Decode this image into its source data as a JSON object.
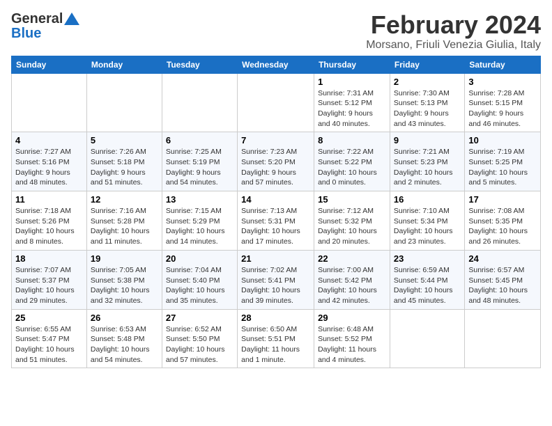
{
  "logo": {
    "general": "General",
    "blue": "Blue"
  },
  "title": {
    "month": "February 2024",
    "location": "Morsano, Friuli Venezia Giulia, Italy"
  },
  "headers": [
    "Sunday",
    "Monday",
    "Tuesday",
    "Wednesday",
    "Thursday",
    "Friday",
    "Saturday"
  ],
  "weeks": [
    [
      {
        "day": "",
        "sunrise": "",
        "sunset": "",
        "daylight": ""
      },
      {
        "day": "",
        "sunrise": "",
        "sunset": "",
        "daylight": ""
      },
      {
        "day": "",
        "sunrise": "",
        "sunset": "",
        "daylight": ""
      },
      {
        "day": "",
        "sunrise": "",
        "sunset": "",
        "daylight": ""
      },
      {
        "day": "1",
        "sunrise": "Sunrise: 7:31 AM",
        "sunset": "Sunset: 5:12 PM",
        "daylight": "Daylight: 9 hours and 40 minutes."
      },
      {
        "day": "2",
        "sunrise": "Sunrise: 7:30 AM",
        "sunset": "Sunset: 5:13 PM",
        "daylight": "Daylight: 9 hours and 43 minutes."
      },
      {
        "day": "3",
        "sunrise": "Sunrise: 7:28 AM",
        "sunset": "Sunset: 5:15 PM",
        "daylight": "Daylight: 9 hours and 46 minutes."
      }
    ],
    [
      {
        "day": "4",
        "sunrise": "Sunrise: 7:27 AM",
        "sunset": "Sunset: 5:16 PM",
        "daylight": "Daylight: 9 hours and 48 minutes."
      },
      {
        "day": "5",
        "sunrise": "Sunrise: 7:26 AM",
        "sunset": "Sunset: 5:18 PM",
        "daylight": "Daylight: 9 hours and 51 minutes."
      },
      {
        "day": "6",
        "sunrise": "Sunrise: 7:25 AM",
        "sunset": "Sunset: 5:19 PM",
        "daylight": "Daylight: 9 hours and 54 minutes."
      },
      {
        "day": "7",
        "sunrise": "Sunrise: 7:23 AM",
        "sunset": "Sunset: 5:20 PM",
        "daylight": "Daylight: 9 hours and 57 minutes."
      },
      {
        "day": "8",
        "sunrise": "Sunrise: 7:22 AM",
        "sunset": "Sunset: 5:22 PM",
        "daylight": "Daylight: 10 hours and 0 minutes."
      },
      {
        "day": "9",
        "sunrise": "Sunrise: 7:21 AM",
        "sunset": "Sunset: 5:23 PM",
        "daylight": "Daylight: 10 hours and 2 minutes."
      },
      {
        "day": "10",
        "sunrise": "Sunrise: 7:19 AM",
        "sunset": "Sunset: 5:25 PM",
        "daylight": "Daylight: 10 hours and 5 minutes."
      }
    ],
    [
      {
        "day": "11",
        "sunrise": "Sunrise: 7:18 AM",
        "sunset": "Sunset: 5:26 PM",
        "daylight": "Daylight: 10 hours and 8 minutes."
      },
      {
        "day": "12",
        "sunrise": "Sunrise: 7:16 AM",
        "sunset": "Sunset: 5:28 PM",
        "daylight": "Daylight: 10 hours and 11 minutes."
      },
      {
        "day": "13",
        "sunrise": "Sunrise: 7:15 AM",
        "sunset": "Sunset: 5:29 PM",
        "daylight": "Daylight: 10 hours and 14 minutes."
      },
      {
        "day": "14",
        "sunrise": "Sunrise: 7:13 AM",
        "sunset": "Sunset: 5:31 PM",
        "daylight": "Daylight: 10 hours and 17 minutes."
      },
      {
        "day": "15",
        "sunrise": "Sunrise: 7:12 AM",
        "sunset": "Sunset: 5:32 PM",
        "daylight": "Daylight: 10 hours and 20 minutes."
      },
      {
        "day": "16",
        "sunrise": "Sunrise: 7:10 AM",
        "sunset": "Sunset: 5:34 PM",
        "daylight": "Daylight: 10 hours and 23 minutes."
      },
      {
        "day": "17",
        "sunrise": "Sunrise: 7:08 AM",
        "sunset": "Sunset: 5:35 PM",
        "daylight": "Daylight: 10 hours and 26 minutes."
      }
    ],
    [
      {
        "day": "18",
        "sunrise": "Sunrise: 7:07 AM",
        "sunset": "Sunset: 5:37 PM",
        "daylight": "Daylight: 10 hours and 29 minutes."
      },
      {
        "day": "19",
        "sunrise": "Sunrise: 7:05 AM",
        "sunset": "Sunset: 5:38 PM",
        "daylight": "Daylight: 10 hours and 32 minutes."
      },
      {
        "day": "20",
        "sunrise": "Sunrise: 7:04 AM",
        "sunset": "Sunset: 5:40 PM",
        "daylight": "Daylight: 10 hours and 35 minutes."
      },
      {
        "day": "21",
        "sunrise": "Sunrise: 7:02 AM",
        "sunset": "Sunset: 5:41 PM",
        "daylight": "Daylight: 10 hours and 39 minutes."
      },
      {
        "day": "22",
        "sunrise": "Sunrise: 7:00 AM",
        "sunset": "Sunset: 5:42 PM",
        "daylight": "Daylight: 10 hours and 42 minutes."
      },
      {
        "day": "23",
        "sunrise": "Sunrise: 6:59 AM",
        "sunset": "Sunset: 5:44 PM",
        "daylight": "Daylight: 10 hours and 45 minutes."
      },
      {
        "day": "24",
        "sunrise": "Sunrise: 6:57 AM",
        "sunset": "Sunset: 5:45 PM",
        "daylight": "Daylight: 10 hours and 48 minutes."
      }
    ],
    [
      {
        "day": "25",
        "sunrise": "Sunrise: 6:55 AM",
        "sunset": "Sunset: 5:47 PM",
        "daylight": "Daylight: 10 hours and 51 minutes."
      },
      {
        "day": "26",
        "sunrise": "Sunrise: 6:53 AM",
        "sunset": "Sunset: 5:48 PM",
        "daylight": "Daylight: 10 hours and 54 minutes."
      },
      {
        "day": "27",
        "sunrise": "Sunrise: 6:52 AM",
        "sunset": "Sunset: 5:50 PM",
        "daylight": "Daylight: 10 hours and 57 minutes."
      },
      {
        "day": "28",
        "sunrise": "Sunrise: 6:50 AM",
        "sunset": "Sunset: 5:51 PM",
        "daylight": "Daylight: 11 hours and 1 minute."
      },
      {
        "day": "29",
        "sunrise": "Sunrise: 6:48 AM",
        "sunset": "Sunset: 5:52 PM",
        "daylight": "Daylight: 11 hours and 4 minutes."
      },
      {
        "day": "",
        "sunrise": "",
        "sunset": "",
        "daylight": ""
      },
      {
        "day": "",
        "sunrise": "",
        "sunset": "",
        "daylight": ""
      }
    ]
  ]
}
